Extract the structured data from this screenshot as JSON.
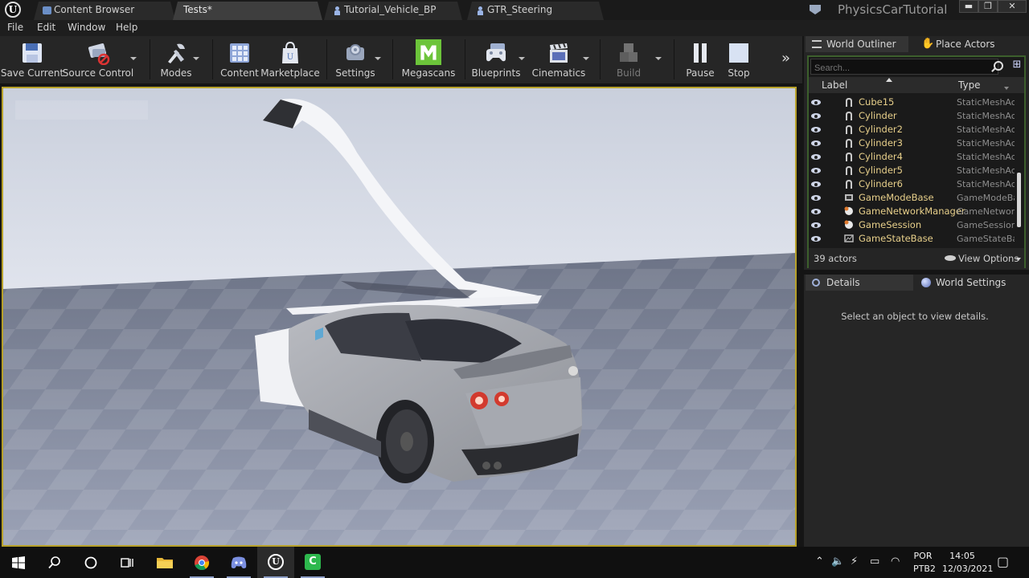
{
  "window": {
    "project_name": "PhysicsCarTutorial",
    "tabs": [
      {
        "label": "Content Browser",
        "active": false
      },
      {
        "label": "Tests*",
        "active": true
      },
      {
        "label": "Tutorial_Vehicle_BP",
        "active": false
      },
      {
        "label": "GTR_Steering",
        "active": false
      }
    ],
    "controls": {
      "minimize": "▬",
      "maximize": "❐",
      "close": "✕"
    }
  },
  "menu": [
    "File",
    "Edit",
    "Window",
    "Help"
  ],
  "toolbar": {
    "buttons": [
      {
        "label": "Save Current",
        "icon": "floppy-disk-icon",
        "enabled": true
      },
      {
        "label": "Source Control",
        "icon": "source-control-icon",
        "enabled": true
      },
      {
        "label": "Modes",
        "icon": "modes-tools-icon",
        "enabled": true
      },
      {
        "label": "Content",
        "icon": "content-grid-icon",
        "enabled": true
      },
      {
        "label": "Marketplace",
        "icon": "marketplace-bag-icon",
        "enabled": true
      },
      {
        "label": "Settings",
        "icon": "settings-gear-icon",
        "enabled": true
      },
      {
        "label": "Megascans",
        "icon": "megascans-m-icon",
        "enabled": true
      },
      {
        "label": "Blueprints",
        "icon": "blueprints-controller-icon",
        "enabled": true
      },
      {
        "label": "Cinematics",
        "icon": "clapperboard-icon",
        "enabled": true
      },
      {
        "label": "Build",
        "icon": "build-blocks-icon",
        "enabled": false
      },
      {
        "label": "Pause",
        "icon": "pause-icon",
        "enabled": true
      },
      {
        "label": "Stop",
        "icon": "stop-icon",
        "enabled": true
      }
    ],
    "more": "»"
  },
  "outliner": {
    "tab_label": "World Outliner",
    "place_actors_label": "Place Actors",
    "search_placeholder": "Search...",
    "col_label": "Label",
    "col_type": "Type",
    "rows": [
      {
        "name": "Cube15",
        "type": "StaticMeshAc",
        "icon": "static-mesh-icon"
      },
      {
        "name": "Cylinder",
        "type": "StaticMeshAc",
        "icon": "static-mesh-icon"
      },
      {
        "name": "Cylinder2",
        "type": "StaticMeshAc",
        "icon": "static-mesh-icon"
      },
      {
        "name": "Cylinder3",
        "type": "StaticMeshAc",
        "icon": "static-mesh-icon"
      },
      {
        "name": "Cylinder4",
        "type": "StaticMeshAc",
        "icon": "static-mesh-icon"
      },
      {
        "name": "Cylinder5",
        "type": "StaticMeshAc",
        "icon": "static-mesh-icon"
      },
      {
        "name": "Cylinder6",
        "type": "StaticMeshAc",
        "icon": "static-mesh-icon"
      },
      {
        "name": "GameModeBase",
        "type": "GameModeBa",
        "icon": "game-mode-icon"
      },
      {
        "name": "GameNetworkManager",
        "type": "GameNetwork",
        "icon": "actor-sphere-icon"
      },
      {
        "name": "GameSession",
        "type": "GameSession",
        "icon": "actor-sphere-icon"
      },
      {
        "name": "GameStateBase",
        "type": "GameStateBa",
        "icon": "game-state-icon"
      }
    ],
    "actor_count": "39 actors",
    "view_options": "View Options"
  },
  "details": {
    "tab_label": "Details",
    "world_settings_label": "World Settings",
    "empty_message": "Select an object to view details."
  },
  "taskbar": {
    "apps": [
      {
        "name": "windows-start-icon"
      },
      {
        "name": "search-icon"
      },
      {
        "name": "cortana-icon"
      },
      {
        "name": "task-view-icon"
      },
      {
        "name": "file-explorer-icon"
      },
      {
        "name": "chrome-icon"
      },
      {
        "name": "discord-icon"
      },
      {
        "name": "unreal-engine-icon"
      },
      {
        "name": "camtasia-icon"
      }
    ],
    "language_line1": "POR",
    "language_line2": "PTB2",
    "time": "14:05",
    "date": "12/03/2021"
  },
  "colors": {
    "viewport_focus_border": "#b7a12a",
    "outliner_focus_border": "#3c5f2c",
    "actor_name": "#e7cf8a",
    "megascans_green": "#6cc43a"
  }
}
